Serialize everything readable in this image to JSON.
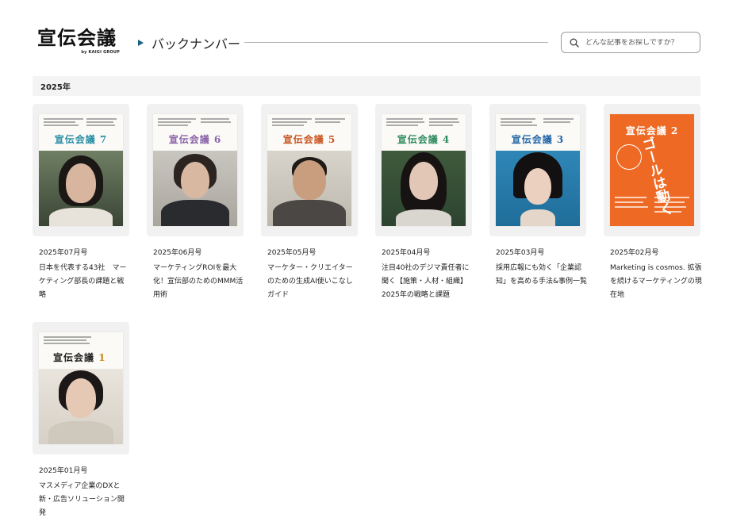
{
  "header": {
    "logo_main": "宣伝会議",
    "logo_sub": "by KAIGI GROUP",
    "section_title": "バックナンバー",
    "search_placeholder": "どんな記事をお探しですか？"
  },
  "year_label": "2025年",
  "issues": [
    {
      "issue": "2025年07月号",
      "cover_title": "宣伝会議",
      "cover_no": "7",
      "accent": "#2a8fa5",
      "desc": "日本を代表する43社　マーケティング部長の課題と戦略"
    },
    {
      "issue": "2025年06月号",
      "cover_title": "宣伝会議",
      "cover_no": "6",
      "accent": "#8a63a8",
      "desc": "マーケティングROIを最大化！宣伝部のためのMMM活用術"
    },
    {
      "issue": "2025年05月号",
      "cover_title": "宣伝会議",
      "cover_no": "5",
      "accent": "#c9541f",
      "desc": "マーケター・クリエイターのための生成AI使いこなしガイド"
    },
    {
      "issue": "2025年04月号",
      "cover_title": "宣伝会議",
      "cover_no": "4",
      "accent": "#2f8b5e",
      "desc": "注目40社のデジマ責任者に聞く【施策・人材・組織】2025年の戦略と課題"
    },
    {
      "issue": "2025年03月号",
      "cover_title": "宣伝会議",
      "cover_no": "3",
      "accent": "#2466a8",
      "desc": "採用広報にも効く「企業認知」を高める手法&事例一覧"
    },
    {
      "issue": "2025年02月号",
      "cover_title": "宣伝会議",
      "cover_no": "2",
      "accent": "#ee6a24",
      "desc": "Marketing is cosmos. 拡張を続けるマーケティングの現在地"
    },
    {
      "issue": "2025年01月号",
      "cover_title": "宣伝会議",
      "cover_no": "1",
      "accent": "#c98a1a",
      "desc": "マスメディア企業のDXと新・広告ソリューション開発"
    }
  ],
  "colors": {
    "year_bar_bg": "#f4f4f4",
    "section_marker": "#1f5f82",
    "card_bg": "#f1f1f1"
  },
  "icons": {
    "search": "search-icon",
    "section_marker": "triangle-right-icon"
  }
}
